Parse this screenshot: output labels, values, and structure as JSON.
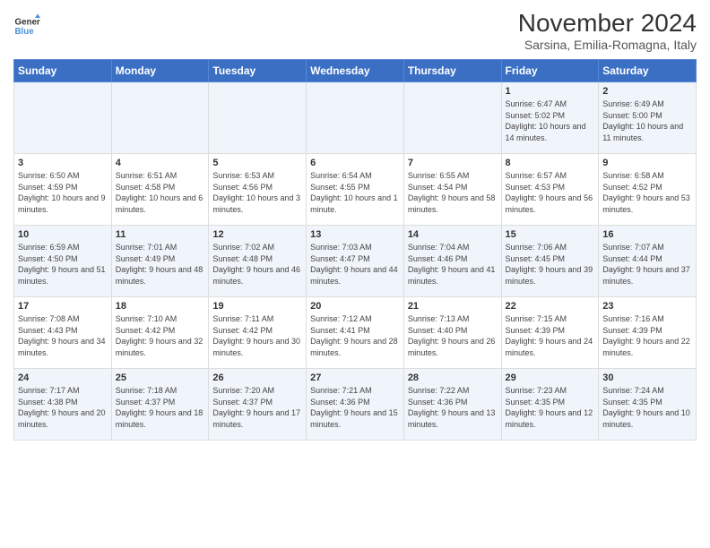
{
  "header": {
    "title": "November 2024",
    "subtitle": "Sarsina, Emilia-Romagna, Italy",
    "logo_line1": "General",
    "logo_line2": "Blue"
  },
  "days_of_week": [
    "Sunday",
    "Monday",
    "Tuesday",
    "Wednesday",
    "Thursday",
    "Friday",
    "Saturday"
  ],
  "weeks": [
    [
      {
        "day": "",
        "info": ""
      },
      {
        "day": "",
        "info": ""
      },
      {
        "day": "",
        "info": ""
      },
      {
        "day": "",
        "info": ""
      },
      {
        "day": "",
        "info": ""
      },
      {
        "day": "1",
        "info": "Sunrise: 6:47 AM\nSunset: 5:02 PM\nDaylight: 10 hours and 14 minutes."
      },
      {
        "day": "2",
        "info": "Sunrise: 6:49 AM\nSunset: 5:00 PM\nDaylight: 10 hours and 11 minutes."
      }
    ],
    [
      {
        "day": "3",
        "info": "Sunrise: 6:50 AM\nSunset: 4:59 PM\nDaylight: 10 hours and 9 minutes."
      },
      {
        "day": "4",
        "info": "Sunrise: 6:51 AM\nSunset: 4:58 PM\nDaylight: 10 hours and 6 minutes."
      },
      {
        "day": "5",
        "info": "Sunrise: 6:53 AM\nSunset: 4:56 PM\nDaylight: 10 hours and 3 minutes."
      },
      {
        "day": "6",
        "info": "Sunrise: 6:54 AM\nSunset: 4:55 PM\nDaylight: 10 hours and 1 minute."
      },
      {
        "day": "7",
        "info": "Sunrise: 6:55 AM\nSunset: 4:54 PM\nDaylight: 9 hours and 58 minutes."
      },
      {
        "day": "8",
        "info": "Sunrise: 6:57 AM\nSunset: 4:53 PM\nDaylight: 9 hours and 56 minutes."
      },
      {
        "day": "9",
        "info": "Sunrise: 6:58 AM\nSunset: 4:52 PM\nDaylight: 9 hours and 53 minutes."
      }
    ],
    [
      {
        "day": "10",
        "info": "Sunrise: 6:59 AM\nSunset: 4:50 PM\nDaylight: 9 hours and 51 minutes."
      },
      {
        "day": "11",
        "info": "Sunrise: 7:01 AM\nSunset: 4:49 PM\nDaylight: 9 hours and 48 minutes."
      },
      {
        "day": "12",
        "info": "Sunrise: 7:02 AM\nSunset: 4:48 PM\nDaylight: 9 hours and 46 minutes."
      },
      {
        "day": "13",
        "info": "Sunrise: 7:03 AM\nSunset: 4:47 PM\nDaylight: 9 hours and 44 minutes."
      },
      {
        "day": "14",
        "info": "Sunrise: 7:04 AM\nSunset: 4:46 PM\nDaylight: 9 hours and 41 minutes."
      },
      {
        "day": "15",
        "info": "Sunrise: 7:06 AM\nSunset: 4:45 PM\nDaylight: 9 hours and 39 minutes."
      },
      {
        "day": "16",
        "info": "Sunrise: 7:07 AM\nSunset: 4:44 PM\nDaylight: 9 hours and 37 minutes."
      }
    ],
    [
      {
        "day": "17",
        "info": "Sunrise: 7:08 AM\nSunset: 4:43 PM\nDaylight: 9 hours and 34 minutes."
      },
      {
        "day": "18",
        "info": "Sunrise: 7:10 AM\nSunset: 4:42 PM\nDaylight: 9 hours and 32 minutes."
      },
      {
        "day": "19",
        "info": "Sunrise: 7:11 AM\nSunset: 4:42 PM\nDaylight: 9 hours and 30 minutes."
      },
      {
        "day": "20",
        "info": "Sunrise: 7:12 AM\nSunset: 4:41 PM\nDaylight: 9 hours and 28 minutes."
      },
      {
        "day": "21",
        "info": "Sunrise: 7:13 AM\nSunset: 4:40 PM\nDaylight: 9 hours and 26 minutes."
      },
      {
        "day": "22",
        "info": "Sunrise: 7:15 AM\nSunset: 4:39 PM\nDaylight: 9 hours and 24 minutes."
      },
      {
        "day": "23",
        "info": "Sunrise: 7:16 AM\nSunset: 4:39 PM\nDaylight: 9 hours and 22 minutes."
      }
    ],
    [
      {
        "day": "24",
        "info": "Sunrise: 7:17 AM\nSunset: 4:38 PM\nDaylight: 9 hours and 20 minutes."
      },
      {
        "day": "25",
        "info": "Sunrise: 7:18 AM\nSunset: 4:37 PM\nDaylight: 9 hours and 18 minutes."
      },
      {
        "day": "26",
        "info": "Sunrise: 7:20 AM\nSunset: 4:37 PM\nDaylight: 9 hours and 17 minutes."
      },
      {
        "day": "27",
        "info": "Sunrise: 7:21 AM\nSunset: 4:36 PM\nDaylight: 9 hours and 15 minutes."
      },
      {
        "day": "28",
        "info": "Sunrise: 7:22 AM\nSunset: 4:36 PM\nDaylight: 9 hours and 13 minutes."
      },
      {
        "day": "29",
        "info": "Sunrise: 7:23 AM\nSunset: 4:35 PM\nDaylight: 9 hours and 12 minutes."
      },
      {
        "day": "30",
        "info": "Sunrise: 7:24 AM\nSunset: 4:35 PM\nDaylight: 9 hours and 10 minutes."
      }
    ]
  ]
}
